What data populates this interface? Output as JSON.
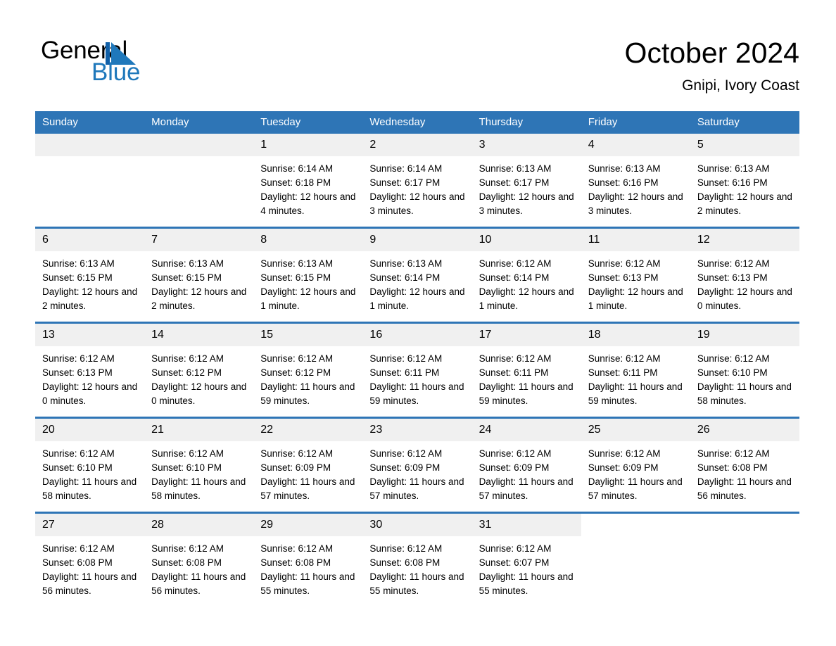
{
  "brand": {
    "name_part1": "General",
    "name_part2": "Blue",
    "logo_icon": "triangle-flag-icon",
    "accent_color": "#1f78bb"
  },
  "header": {
    "month_title": "October 2024",
    "location": "Gnipi, Ivory Coast"
  },
  "theme": {
    "header_blue": "#2e75b6",
    "daynum_band": "#f0f0f0",
    "text": "#000000"
  },
  "calendar": {
    "weekday_headers": [
      "Sunday",
      "Monday",
      "Tuesday",
      "Wednesday",
      "Thursday",
      "Friday",
      "Saturday"
    ],
    "weeks": [
      [
        {
          "day": "",
          "sunrise": "",
          "sunset": "",
          "daylight": "",
          "empty": true
        },
        {
          "day": "",
          "sunrise": "",
          "sunset": "",
          "daylight": "",
          "empty": true
        },
        {
          "day": "1",
          "sunrise": "Sunrise: 6:14 AM",
          "sunset": "Sunset: 6:18 PM",
          "daylight": "Daylight: 12 hours and 4 minutes."
        },
        {
          "day": "2",
          "sunrise": "Sunrise: 6:14 AM",
          "sunset": "Sunset: 6:17 PM",
          "daylight": "Daylight: 12 hours and 3 minutes."
        },
        {
          "day": "3",
          "sunrise": "Sunrise: 6:13 AM",
          "sunset": "Sunset: 6:17 PM",
          "daylight": "Daylight: 12 hours and 3 minutes."
        },
        {
          "day": "4",
          "sunrise": "Sunrise: 6:13 AM",
          "sunset": "Sunset: 6:16 PM",
          "daylight": "Daylight: 12 hours and 3 minutes."
        },
        {
          "day": "5",
          "sunrise": "Sunrise: 6:13 AM",
          "sunset": "Sunset: 6:16 PM",
          "daylight": "Daylight: 12 hours and 2 minutes."
        }
      ],
      [
        {
          "day": "6",
          "sunrise": "Sunrise: 6:13 AM",
          "sunset": "Sunset: 6:15 PM",
          "daylight": "Daylight: 12 hours and 2 minutes."
        },
        {
          "day": "7",
          "sunrise": "Sunrise: 6:13 AM",
          "sunset": "Sunset: 6:15 PM",
          "daylight": "Daylight: 12 hours and 2 minutes."
        },
        {
          "day": "8",
          "sunrise": "Sunrise: 6:13 AM",
          "sunset": "Sunset: 6:15 PM",
          "daylight": "Daylight: 12 hours and 1 minute."
        },
        {
          "day": "9",
          "sunrise": "Sunrise: 6:13 AM",
          "sunset": "Sunset: 6:14 PM",
          "daylight": "Daylight: 12 hours and 1 minute."
        },
        {
          "day": "10",
          "sunrise": "Sunrise: 6:12 AM",
          "sunset": "Sunset: 6:14 PM",
          "daylight": "Daylight: 12 hours and 1 minute."
        },
        {
          "day": "11",
          "sunrise": "Sunrise: 6:12 AM",
          "sunset": "Sunset: 6:13 PM",
          "daylight": "Daylight: 12 hours and 1 minute."
        },
        {
          "day": "12",
          "sunrise": "Sunrise: 6:12 AM",
          "sunset": "Sunset: 6:13 PM",
          "daylight": "Daylight: 12 hours and 0 minutes."
        }
      ],
      [
        {
          "day": "13",
          "sunrise": "Sunrise: 6:12 AM",
          "sunset": "Sunset: 6:13 PM",
          "daylight": "Daylight: 12 hours and 0 minutes."
        },
        {
          "day": "14",
          "sunrise": "Sunrise: 6:12 AM",
          "sunset": "Sunset: 6:12 PM",
          "daylight": "Daylight: 12 hours and 0 minutes."
        },
        {
          "day": "15",
          "sunrise": "Sunrise: 6:12 AM",
          "sunset": "Sunset: 6:12 PM",
          "daylight": "Daylight: 11 hours and 59 minutes."
        },
        {
          "day": "16",
          "sunrise": "Sunrise: 6:12 AM",
          "sunset": "Sunset: 6:11 PM",
          "daylight": "Daylight: 11 hours and 59 minutes."
        },
        {
          "day": "17",
          "sunrise": "Sunrise: 6:12 AM",
          "sunset": "Sunset: 6:11 PM",
          "daylight": "Daylight: 11 hours and 59 minutes."
        },
        {
          "day": "18",
          "sunrise": "Sunrise: 6:12 AM",
          "sunset": "Sunset: 6:11 PM",
          "daylight": "Daylight: 11 hours and 59 minutes."
        },
        {
          "day": "19",
          "sunrise": "Sunrise: 6:12 AM",
          "sunset": "Sunset: 6:10 PM",
          "daylight": "Daylight: 11 hours and 58 minutes."
        }
      ],
      [
        {
          "day": "20",
          "sunrise": "Sunrise: 6:12 AM",
          "sunset": "Sunset: 6:10 PM",
          "daylight": "Daylight: 11 hours and 58 minutes."
        },
        {
          "day": "21",
          "sunrise": "Sunrise: 6:12 AM",
          "sunset": "Sunset: 6:10 PM",
          "daylight": "Daylight: 11 hours and 58 minutes."
        },
        {
          "day": "22",
          "sunrise": "Sunrise: 6:12 AM",
          "sunset": "Sunset: 6:09 PM",
          "daylight": "Daylight: 11 hours and 57 minutes."
        },
        {
          "day": "23",
          "sunrise": "Sunrise: 6:12 AM",
          "sunset": "Sunset: 6:09 PM",
          "daylight": "Daylight: 11 hours and 57 minutes."
        },
        {
          "day": "24",
          "sunrise": "Sunrise: 6:12 AM",
          "sunset": "Sunset: 6:09 PM",
          "daylight": "Daylight: 11 hours and 57 minutes."
        },
        {
          "day": "25",
          "sunrise": "Sunrise: 6:12 AM",
          "sunset": "Sunset: 6:09 PM",
          "daylight": "Daylight: 11 hours and 57 minutes."
        },
        {
          "day": "26",
          "sunrise": "Sunrise: 6:12 AM",
          "sunset": "Sunset: 6:08 PM",
          "daylight": "Daylight: 11 hours and 56 minutes."
        }
      ],
      [
        {
          "day": "27",
          "sunrise": "Sunrise: 6:12 AM",
          "sunset": "Sunset: 6:08 PM",
          "daylight": "Daylight: 11 hours and 56 minutes."
        },
        {
          "day": "28",
          "sunrise": "Sunrise: 6:12 AM",
          "sunset": "Sunset: 6:08 PM",
          "daylight": "Daylight: 11 hours and 56 minutes."
        },
        {
          "day": "29",
          "sunrise": "Sunrise: 6:12 AM",
          "sunset": "Sunset: 6:08 PM",
          "daylight": "Daylight: 11 hours and 55 minutes."
        },
        {
          "day": "30",
          "sunrise": "Sunrise: 6:12 AM",
          "sunset": "Sunset: 6:08 PM",
          "daylight": "Daylight: 11 hours and 55 minutes."
        },
        {
          "day": "31",
          "sunrise": "Sunrise: 6:12 AM",
          "sunset": "Sunset: 6:07 PM",
          "daylight": "Daylight: 11 hours and 55 minutes."
        },
        {
          "day": "",
          "sunrise": "",
          "sunset": "",
          "daylight": "",
          "empty": true,
          "blank": true
        },
        {
          "day": "",
          "sunrise": "",
          "sunset": "",
          "daylight": "",
          "empty": true,
          "blank": true
        }
      ]
    ]
  }
}
